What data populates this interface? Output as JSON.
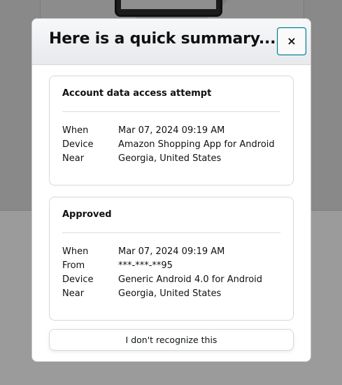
{
  "modal": {
    "title": "Here is a quick summary...",
    "close_icon": "×",
    "colors": {
      "focus_ring": "#007185",
      "header_bg": "#eef0f2",
      "border": "#d5d9d9"
    }
  },
  "access_attempt": {
    "heading": "Account data access attempt",
    "rows": [
      {
        "label": "When",
        "value": "Mar 07, 2024 09:19 AM"
      },
      {
        "label": "Device",
        "value": "Amazon Shopping App for Android"
      },
      {
        "label": "Near",
        "value": "Georgia, United States"
      }
    ]
  },
  "approved": {
    "heading": "Approved",
    "rows": [
      {
        "label": "When",
        "value": "Mar 07, 2024 09:19 AM"
      },
      {
        "label": "From",
        "value": "***-***-**95"
      },
      {
        "label": "Device",
        "value": "Generic Android 4.0 for Android"
      },
      {
        "label": "Near",
        "value": "Georgia, United States"
      }
    ]
  },
  "actions": {
    "report_label": "I don't recognize this"
  }
}
